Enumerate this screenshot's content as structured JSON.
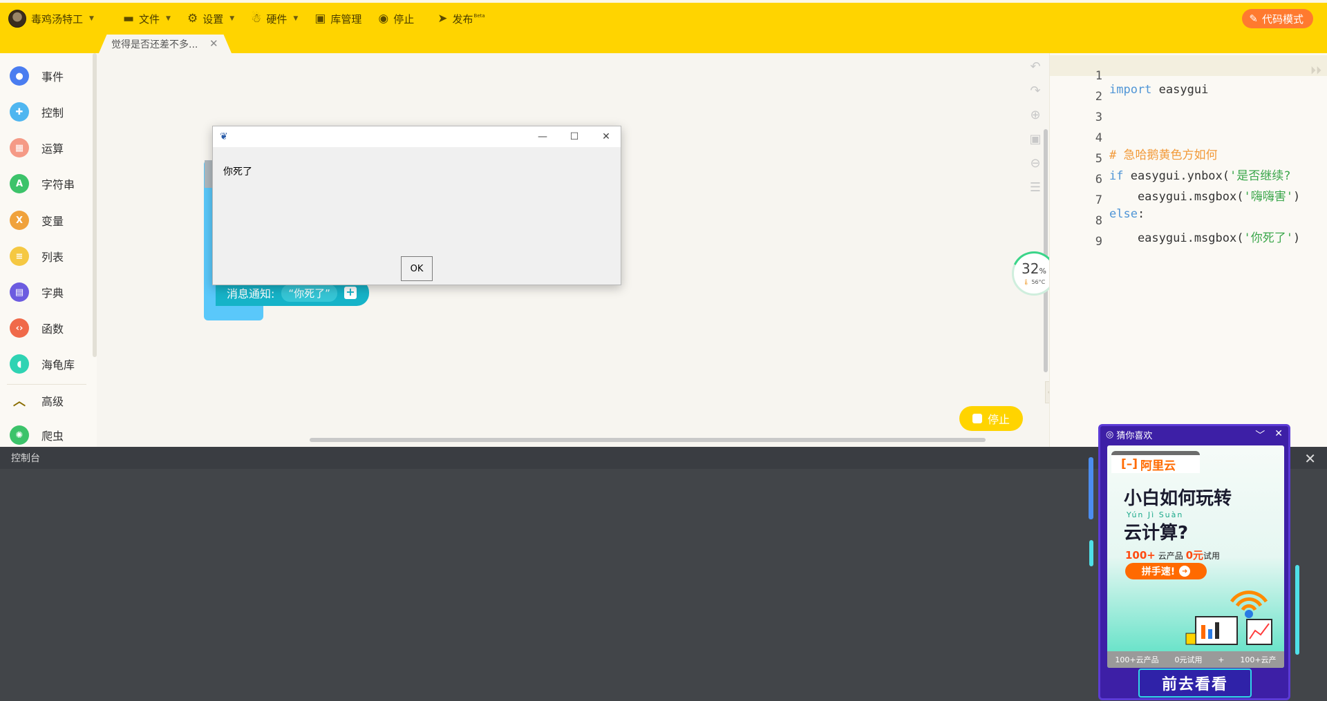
{
  "toolbar": {
    "user": "毒鸡汤特工",
    "file": "文件",
    "settings": "设置",
    "hardware": "硬件",
    "library": "库管理",
    "stop": "停止",
    "publish": "发布",
    "publish_badge": "Beta",
    "code_mode": "代码模式"
  },
  "tabs": [
    {
      "label": "觉得是否还差不多..."
    }
  ],
  "sidebar": {
    "items": [
      {
        "label": "事件",
        "color": "#4a7df0"
      },
      {
        "label": "控制",
        "color": "#4fb6f0"
      },
      {
        "label": "运算",
        "color": "#f59a86"
      },
      {
        "label": "字符串",
        "color": "#3cc36a"
      },
      {
        "label": "变量",
        "color": "#f0a23c"
      },
      {
        "label": "列表",
        "color": "#f5c842"
      },
      {
        "label": "字典",
        "color": "#6c5ce0"
      },
      {
        "label": "函数",
        "color": "#f06a4a"
      },
      {
        "label": "海龟库",
        "color": "#2fd3b3"
      },
      {
        "label": "高级",
        "color": "#8a6d00"
      },
      {
        "label": "爬虫",
        "color": "#3cc36a"
      }
    ]
  },
  "workspace": {
    "block_label": "消息通知:",
    "block_string": "“你死了”",
    "cpu_percent": "32",
    "cpu_unit": "%",
    "temperature": "56°C",
    "stop_label": "停止"
  },
  "dialog": {
    "message": "你死了",
    "ok_label": "OK"
  },
  "editor": {
    "lines": [
      {
        "no": "1",
        "code": "import easygui"
      },
      {
        "no": "2",
        "code": ""
      },
      {
        "no": "3",
        "code": ""
      },
      {
        "no": "4",
        "code": "# 急哈鹅黄色方如何"
      },
      {
        "no": "5",
        "code": "if easygui.ynbox('是否继续?"
      },
      {
        "no": "6",
        "code": "    easygui.msgbox('嗨嗨害')"
      },
      {
        "no": "7",
        "code": "else:"
      },
      {
        "no": "8",
        "code": "    easygui.msgbox('你死了')"
      },
      {
        "no": "9",
        "code": ""
      }
    ]
  },
  "console": {
    "title": "控制台"
  },
  "ad": {
    "title": "猜你喜欢",
    "brand": "阿里云",
    "headline1": "小白如何玩转",
    "pinyin": "Yún  Jì  Suàn",
    "headline2": "云计算?",
    "offer_prefix": "100+",
    "offer_mid": "云产品",
    "offer_price": "0元",
    "offer_suffix": "试用",
    "cta": "拼手速!",
    "strip1": "100+云产品",
    "strip2": "0元试用",
    "strip3": "+",
    "strip4": "100+云产",
    "go_label": "前去看看"
  }
}
